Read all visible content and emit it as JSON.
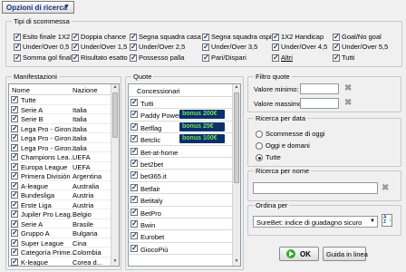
{
  "options_button": "Opzioni di ricerca",
  "bet_types": {
    "title": "Tipi di scommessa",
    "items": [
      {
        "label": "Esito finale 1X2",
        "checked": true
      },
      {
        "label": "Doppia chance",
        "checked": true
      },
      {
        "label": "Segna squadra casa",
        "checked": true
      },
      {
        "label": "Segna squadra ospite",
        "checked": true
      },
      {
        "label": "1X2 Handicap",
        "checked": true
      },
      {
        "label": "Goal/No goal",
        "checked": true
      },
      {
        "label": "Under/Over 0,5",
        "checked": true
      },
      {
        "label": "Under/Over 1,5",
        "checked": true
      },
      {
        "label": "Under/Over 2,5",
        "checked": true
      },
      {
        "label": "Under/Over 3,5",
        "checked": true
      },
      {
        "label": "Under/Over 4,5",
        "checked": true
      },
      {
        "label": "Under/Over 5,5",
        "checked": true
      },
      {
        "label": "Somma gol finale",
        "checked": true
      },
      {
        "label": "Risultato esatto",
        "checked": true
      },
      {
        "label": "Possesso palla",
        "checked": true
      },
      {
        "label": "Pari/Dispari",
        "checked": true
      },
      {
        "label": "Altri",
        "checked": true
      },
      {
        "label": "Tutti",
        "checked": true
      }
    ]
  },
  "events": {
    "title": "Manifestazioni",
    "col_name": "Nome",
    "col_nation": "Nazione",
    "rows": [
      {
        "name": "Tutte",
        "nation": ""
      },
      {
        "name": "Serie A",
        "nation": "Italia"
      },
      {
        "name": "Serie B",
        "nation": "Italia"
      },
      {
        "name": "Lega Pro - Giron...",
        "nation": "Italia"
      },
      {
        "name": "Lega Pro - Giron...",
        "nation": "Italia"
      },
      {
        "name": "Lega Pro - Giron...",
        "nation": "Italia"
      },
      {
        "name": "Champions Lea...",
        "nation": "UEFA"
      },
      {
        "name": "Europa League",
        "nation": "UEFA"
      },
      {
        "name": "Primera División",
        "nation": "Argentina"
      },
      {
        "name": "A-league",
        "nation": "Australia"
      },
      {
        "name": "Bundesliga",
        "nation": "Austria"
      },
      {
        "name": "Erste Liga",
        "nation": "Austria"
      },
      {
        "name": "Jupiler Pro Leag...",
        "nation": "Belgio"
      },
      {
        "name": "Serie A",
        "nation": "Brasile"
      },
      {
        "name": "Gruppo A",
        "nation": "Bulgaria"
      },
      {
        "name": "Super League",
        "nation": "Cina"
      },
      {
        "name": "Categoría Prime...",
        "nation": "Colombia"
      },
      {
        "name": "K-league",
        "nation": "Corea d..."
      }
    ]
  },
  "bookmakers": {
    "title": "Quote",
    "header": "Concessionari",
    "rows": [
      {
        "name": "Tutti",
        "bonus": ""
      },
      {
        "name": "Paddy Power",
        "bonus": "bonus 200€"
      },
      {
        "name": "Betflag",
        "bonus": "bonus 25€"
      },
      {
        "name": "Betclic",
        "bonus": "bonus 100€"
      },
      {
        "name": "Bet-at-home",
        "bonus": ""
      },
      {
        "name": "bet2bet",
        "bonus": ""
      },
      {
        "name": "bet365.it",
        "bonus": ""
      },
      {
        "name": "Betfair",
        "bonus": ""
      },
      {
        "name": "Betitaly",
        "bonus": ""
      },
      {
        "name": "BetPro",
        "bonus": ""
      },
      {
        "name": "Bwin",
        "bonus": ""
      },
      {
        "name": "Eurobet",
        "bonus": ""
      },
      {
        "name": "GiocoPiù",
        "bonus": ""
      }
    ]
  },
  "filter_odds": {
    "title": "Filtro quote",
    "min_label": "Valore minimo:",
    "max_label": "Valore massimo:",
    "min_value": "",
    "max_value": ""
  },
  "date_search": {
    "title": "Ricerca per data",
    "options": [
      {
        "label": "Scommesse di oggi",
        "selected": false
      },
      {
        "label": "Oggi e domani",
        "selected": false
      },
      {
        "label": "Tutte",
        "selected": true
      }
    ]
  },
  "name_search": {
    "title": "Ricerca per nome",
    "value": ""
  },
  "sort": {
    "title": "Ordina per",
    "selected": "SureBet: indice di guadagno sicuro"
  },
  "ok_label": "OK",
  "help_label": "Guida in linea",
  "colors": {
    "bonus_bg": "#08306b",
    "bonus_text": "#7fdc5f",
    "ok_icon": "#3aa82e"
  }
}
